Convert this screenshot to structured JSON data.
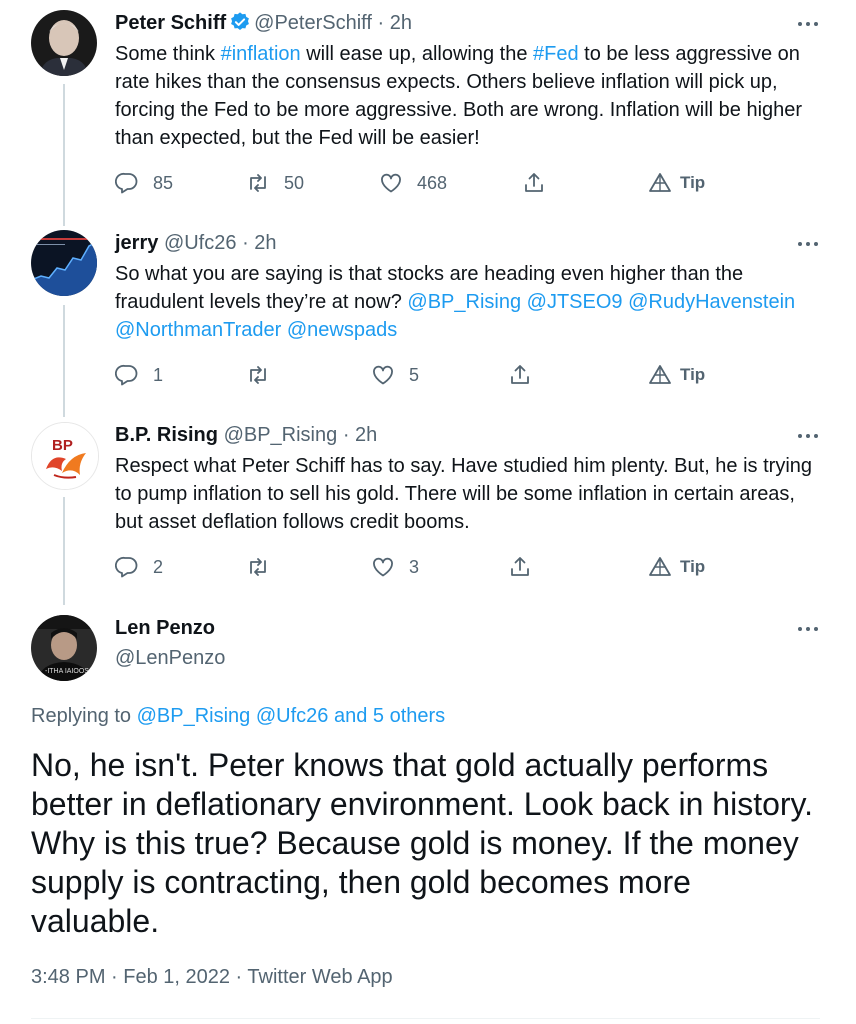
{
  "tweets": [
    {
      "name": "Peter Schiff",
      "handle": "@PeterSchiff",
      "time": "2h",
      "verified": true,
      "text_parts": [
        "Some think ",
        "#inflation",
        " will ease up, allowing the ",
        "#Fed",
        " to be less aggressive on rate hikes than the consensus expects. Others believe inflation will pick up, forcing the Fed to be more aggressive. Both are wrong. Inflation will be higher than expected, but the Fed will be easier!"
      ],
      "replies": "85",
      "retweets": "50",
      "likes": "468",
      "tip": "Tip"
    },
    {
      "name": "jerry",
      "handle": "@Ufc26",
      "time": "2h",
      "text_parts": [
        "So what you are saying is that stocks are heading even higher than the fraudulent levels they’re at now? ",
        "@BP_Rising @JTSEO9 @RudyHavenstein @NorthmanTrader @newspads"
      ],
      "replies": "1",
      "retweets": "",
      "likes": "5",
      "tip": "Tip"
    },
    {
      "name": "B.P. Rising",
      "handle": "@BP_Rising",
      "time": "2h",
      "avatar_text": "BP",
      "text": "Respect what Peter Schiff has to say. Have studied him plenty. But, he is trying to pump inflation to sell his gold. There will be some inflation in certain areas, but asset deflation follows credit booms.",
      "replies": "2",
      "retweets": "",
      "likes": "3",
      "tip": "Tip"
    }
  ],
  "main_tweet": {
    "name": "Len Penzo",
    "handle": "@LenPenzo",
    "avatar_text": "-ITHA\nIAIOOS",
    "replying_prefix": "Replying to ",
    "replying_to": "@BP_Rising @Ufc26 and 5 others",
    "text": "No, he isn't. Peter knows that gold actually performs better in deflationary environment. Look back in history. Why is this true? Because gold is money. If the money supply is contracting, then gold becomes more valuable.",
    "meta": "3:48 PM · Feb 1, 2022 · Twitter Web App"
  },
  "separator": "·",
  "colors": {
    "link": "#1d9bf0",
    "muted": "#536471",
    "verified": "#1d9bf0",
    "text": "#0f1419"
  },
  "icons": [
    "verified-badge-icon",
    "more-icon",
    "reply-icon",
    "retweet-icon",
    "like-icon",
    "share-icon",
    "tip-icon"
  ]
}
